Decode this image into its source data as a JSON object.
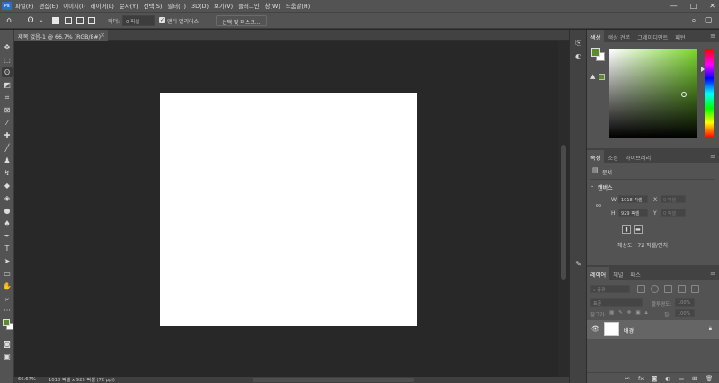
{
  "menubar": {
    "logo": "Ps",
    "items": [
      "파일(F)",
      "편집(E)",
      "이미지(I)",
      "레이어(L)",
      "문자(Y)",
      "선택(S)",
      "필터(T)",
      "3D(D)",
      "보기(V)",
      "플러그인",
      "창(W)",
      "도움말(H)"
    ],
    "controls": {
      "minimize": "—",
      "maximize": "□",
      "close": "✕"
    }
  },
  "options": {
    "feather_label": "페더:",
    "feather_value": "0 픽셀",
    "antialias_label": "앤티 앨리어스",
    "select_mask_label": "선택 및 마스크..."
  },
  "document": {
    "tab_title": "제목 없음-1 @ 66.7% (RGB/8#)",
    "close_glyph": "×",
    "status_zoom": "66.67%",
    "status_info": "1018 픽셀 x 929 픽셀 (72 ppi)"
  },
  "color_panel": {
    "tabs": [
      "색상",
      "색상 견본",
      "그레이디언트",
      "패턴"
    ],
    "foreground": "#5b8c2a",
    "background": "#ffffff"
  },
  "properties_panel": {
    "tabs": [
      "속성",
      "조정",
      "라이브러리"
    ],
    "doc_label": "문서",
    "section_title": "캔버스",
    "w_label": "W",
    "w_value": "1018 픽셀",
    "h_label": "H",
    "h_value": "929 픽셀",
    "x_label": "X",
    "x_value": "0 픽셀",
    "y_label": "Y",
    "y_value": "0 픽셀",
    "resolution": "해상도 : 72 픽셀/인치"
  },
  "layers_panel": {
    "tabs": [
      "레이어",
      "채널",
      "패스"
    ],
    "search_placeholder": "종류",
    "blend_mode": "표준",
    "opacity_label": "불투명도:",
    "opacity_value": "100%",
    "lock_label": "잠그기:",
    "fill_label": "칠:",
    "fill_value": "100%",
    "layer_name": "배경"
  }
}
